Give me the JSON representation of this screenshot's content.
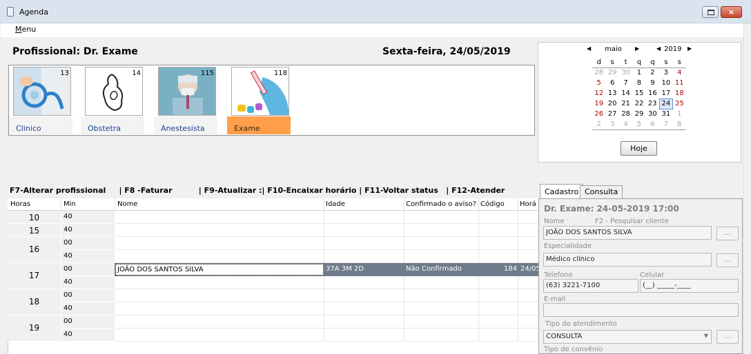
{
  "window": {
    "title": "Agenda",
    "close_glyph": "×"
  },
  "menu": {
    "label_first": "M",
    "label_rest": "enu"
  },
  "header": {
    "professional": "Profissional: Dr. Exame",
    "date": "Sexta-feira, 24/05/2019"
  },
  "professionals": [
    {
      "label": "Clinico",
      "count": "13",
      "icon": "stethoscope-icon",
      "selected": false
    },
    {
      "label": "Obstetra",
      "count": "14",
      "icon": "pregnancy-icon",
      "selected": false
    },
    {
      "label": "Anestesista",
      "count": "115",
      "icon": "anesthesia-icon",
      "selected": false
    },
    {
      "label": "Exame",
      "count": "118",
      "icon": "blood-tube-icon",
      "selected": true
    }
  ],
  "calendar": {
    "month": "maio",
    "year": "2019",
    "dow": [
      "d",
      "s",
      "t",
      "q",
      "q",
      "s",
      "s"
    ],
    "today_button": "Hoje"
  },
  "fkeys": "F7-Alterar profissional     | F8 -Faturar          | F9-Atualizar :| F10-Encaixar horário | F11-Voltar status   | F12-Atender",
  "grid": {
    "headers": [
      "Horas",
      "Min",
      "Nome",
      "Idade",
      "Confirmado o aviso?",
      "Código",
      "Horá"
    ],
    "hours": [
      "10",
      "15",
      "16",
      "17",
      "18",
      "19"
    ],
    "minutes": [
      "40",
      "40",
      "00",
      "40",
      "00",
      "40",
      "00",
      "40",
      "00",
      "40"
    ],
    "selected_row": {
      "name": "JOÃO DOS SANTOS SILVA",
      "age": "37A 3M 2D",
      "confirm": "Não Confirmado",
      "code": "184",
      "date": "24/05"
    }
  },
  "form": {
    "tabs": [
      "Cadastro",
      "Consulta"
    ],
    "title": "Dr. Exame: 24-05-2019 17:00",
    "name_label": "Nome",
    "search_hint": "F2 - Pesquisar cliente",
    "name_value": "JOÃO DOS SANTOS SILVA",
    "specialty_label": "Especialidade",
    "specialty_value": "Médico clínico",
    "phone_label": "Telefone",
    "phone_value": "(63) 3221-7100",
    "cell_label": "Celular",
    "cell_value": "(__) _____-____",
    "email_label": "E-mail",
    "email_value": "",
    "service_label": "Tipo do atendimento",
    "service_value": "CONSULTA",
    "insurance_label": "Tipo de convênio",
    "ellipsis": "..."
  }
}
